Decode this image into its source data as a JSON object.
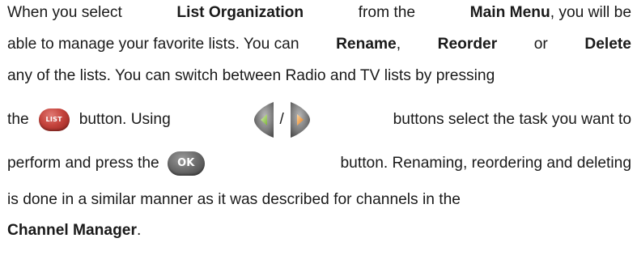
{
  "paragraph": {
    "l1_a": "When you select",
    "l1_b": "List Organization",
    "l1_c": "from the",
    "l1_d": "Main Menu",
    "l1_e": ", you will be",
    "l2_a": "able to manage your favorite lists. You can",
    "l2_b": "Rename",
    "l2_c": ",",
    "l2_d": "Reorder",
    "l2_e": "or",
    "l2_f": "Delete",
    "l3": "any of the lists. You can switch between Radio and TV lists by pressing",
    "l4_a": "the",
    "l4_b": "button. Using",
    "l4_slash": "/",
    "l4_c": "buttons select the task you want to",
    "l5_a": "perform and press the",
    "l5_b": "button. Renaming, reordering and deleting",
    "l6": "is done in a similar manner as it was described for channels in the",
    "l7_a": "Channel Manager",
    "l7_b": "."
  },
  "icons": {
    "list_button_label": "LIST",
    "ok_button_label": "OK"
  }
}
